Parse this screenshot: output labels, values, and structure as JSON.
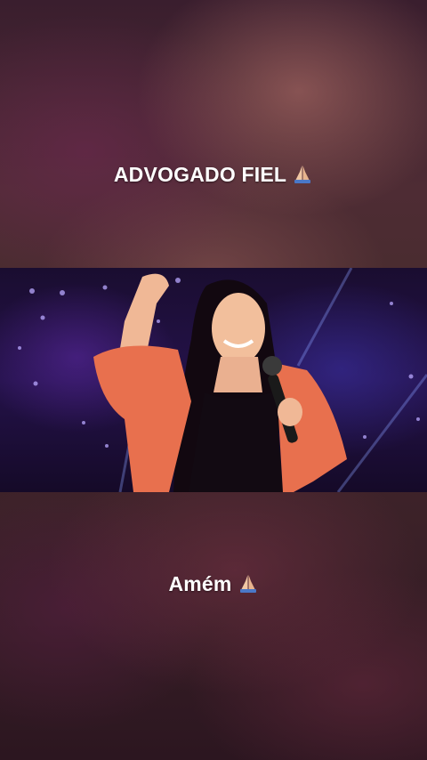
{
  "captions": {
    "top": "ADVOGADO FIEL",
    "bottom": "Amém"
  },
  "icons": {
    "top_caption_icon": "folded-hands-icon",
    "bottom_caption_icon": "folded-hands-icon"
  },
  "colors": {
    "caption_text": "#ffffff",
    "stage_background": "#24124a",
    "blazer": "#e8704e"
  }
}
